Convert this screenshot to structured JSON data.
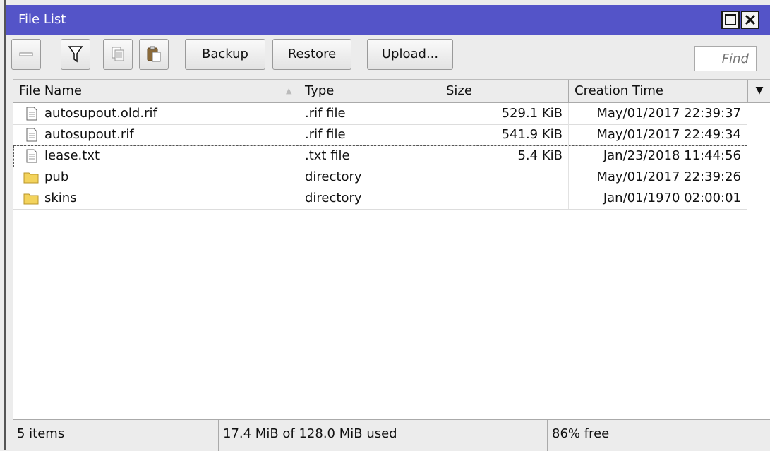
{
  "window": {
    "title": "File List"
  },
  "toolbar": {
    "remove_icon": "minus-icon",
    "filter_icon": "funnel-icon",
    "copy_icon": "copy-icon",
    "paste_icon": "paste-icon",
    "backup_label": "Backup",
    "restore_label": "Restore",
    "upload_label": "Upload...",
    "find_placeholder": "Find"
  },
  "table": {
    "columns": [
      "File Name",
      "Type",
      "Size",
      "Creation Time"
    ],
    "rows": [
      {
        "name": "autosupout.old.rif",
        "type": ".rif file",
        "size": "529.1 KiB",
        "time": "May/01/2017 22:39:37",
        "icon": "file-icon"
      },
      {
        "name": "autosupout.rif",
        "type": ".rif file",
        "size": "541.9 KiB",
        "time": "May/01/2017 22:49:34",
        "icon": "file-icon"
      },
      {
        "name": "lease.txt",
        "type": ".txt file",
        "size": "5.4 KiB",
        "time": "Jan/23/2018 11:44:56",
        "icon": "file-icon"
      },
      {
        "name": "pub",
        "type": "directory",
        "size": "",
        "time": "May/01/2017 22:39:26",
        "icon": "folder-icon"
      },
      {
        "name": "skins",
        "type": "directory",
        "size": "",
        "time": "Jan/01/1970 02:00:01",
        "icon": "folder-icon"
      }
    ]
  },
  "status": {
    "items": "5 items",
    "used": "17.4 MiB of 128.0 MiB used",
    "free": "86% free"
  },
  "colors": {
    "titlebar": "#5454c8",
    "folder": "#f3d35c"
  }
}
